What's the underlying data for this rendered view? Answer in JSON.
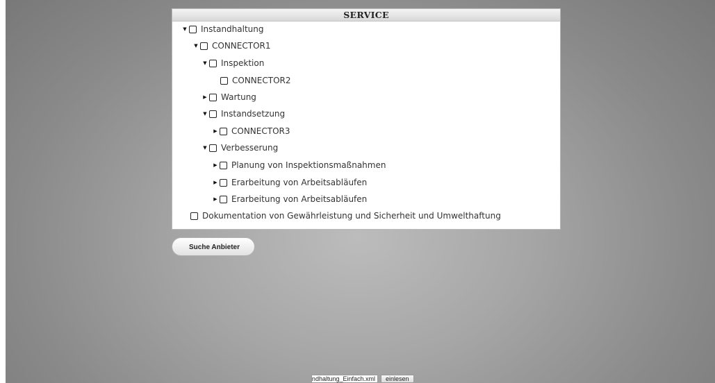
{
  "panel": {
    "title": "SERVICE"
  },
  "tree": [
    {
      "label": "Instandhaltung",
      "toggle": "expanded",
      "checked": false
    },
    {
      "label": "CONNECTOR1",
      "toggle": "expanded",
      "checked": false
    },
    {
      "label": "Inspektion",
      "toggle": "expanded",
      "checked": false
    },
    {
      "label": "CONNECTOR2",
      "toggle": "none",
      "checked": false
    },
    {
      "label": "Wartung",
      "toggle": "collapsed",
      "checked": false
    },
    {
      "label": "Instandsetzung",
      "toggle": "expanded",
      "checked": false
    },
    {
      "label": "CONNECTOR3",
      "toggle": "collapsed",
      "checked": false
    },
    {
      "label": "Verbesserung",
      "toggle": "expanded",
      "checked": false
    },
    {
      "label": "Planung von Inspektionsmaßnahmen",
      "toggle": "collapsed",
      "checked": false
    },
    {
      "label": "Erarbeitung von Arbeitsabläufen",
      "toggle": "collapsed",
      "checked": false
    },
    {
      "label": "Erarbeitung von Arbeitsabläufen",
      "toggle": "collapsed",
      "checked": false
    },
    {
      "label": "Dokumentation von Gewährleistung und Sicherheit und Umwelthaftung",
      "toggle": "none",
      "checked": false
    }
  ],
  "toggle_glyphs": {
    "expanded": "▼",
    "collapsed": "▶",
    "none": ""
  },
  "actions": {
    "search_label": "Suche Anbieter"
  },
  "file": {
    "name": "Instandhaltung_Einfach.xml",
    "read_label": "einlesen"
  }
}
